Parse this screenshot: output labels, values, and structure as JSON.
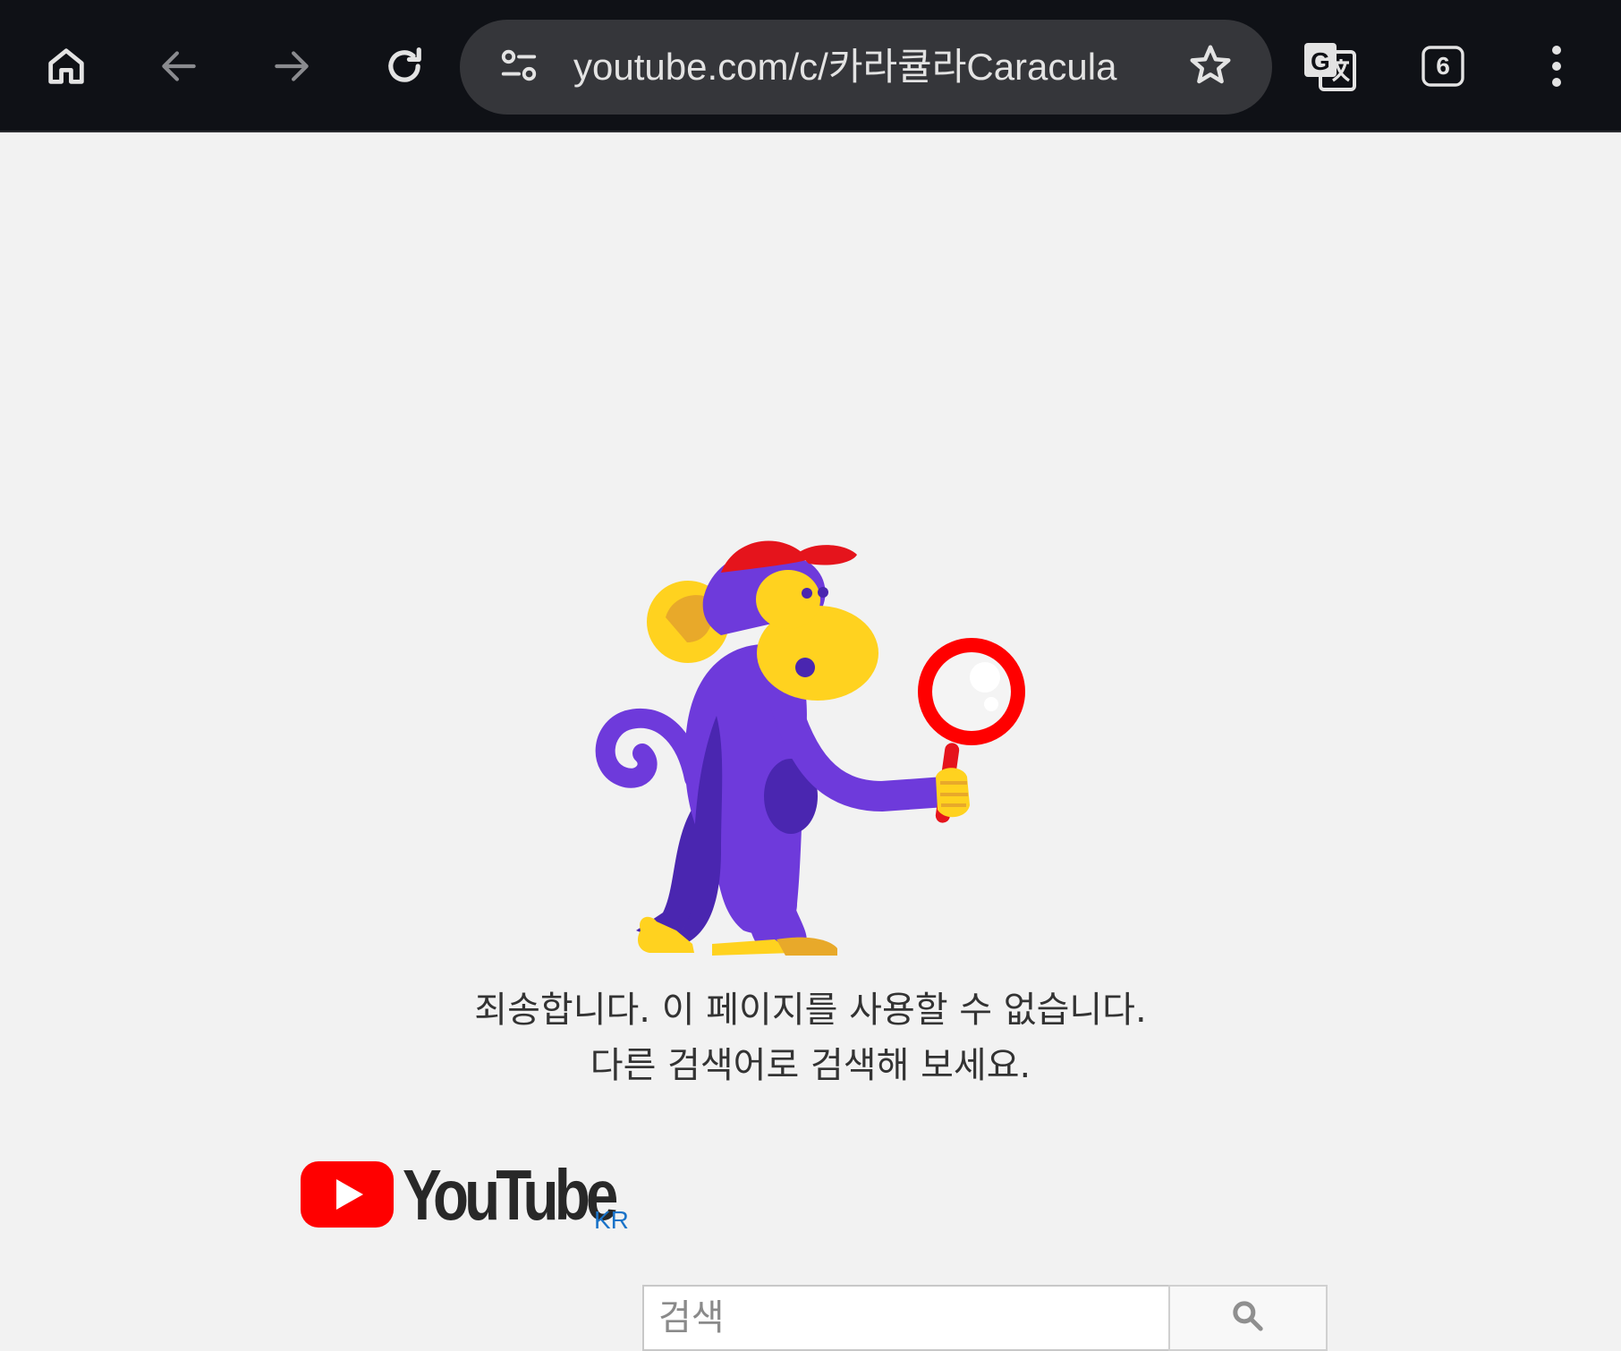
{
  "browser": {
    "url": "youtube.com/c/카라큘라Caracula",
    "tab_count": "6",
    "buttons": {
      "home": "home-icon",
      "back": "arrow-left-icon",
      "forward": "arrow-right-icon",
      "reload": "reload-icon",
      "site_info": "tune-icon",
      "bookmark": "star-icon",
      "translate": "google-translate-icon",
      "tabs": "tab-switcher-icon",
      "menu": "more-vert-icon"
    },
    "colors": {
      "toolbar_bg": "#0f1116",
      "omnibox_bg": "#35363a",
      "icon": "#e3e3e3",
      "icon_disabled": "#8a8b8f"
    }
  },
  "error_page": {
    "illustration": "monkey-with-magnifying-glass",
    "message_line1": "죄송합니다. 이 페이지를 사용할 수 없습니다.",
    "message_line2": "다른 검색어로 검색해 보세요.",
    "logo": {
      "wordmark": "YouTube",
      "region": "KR"
    },
    "search": {
      "placeholder": "검색",
      "value": ""
    },
    "colors": {
      "brand_red": "#ff0000",
      "region_blue": "#1a73c8",
      "page_bg": "#f2f2f2"
    }
  }
}
